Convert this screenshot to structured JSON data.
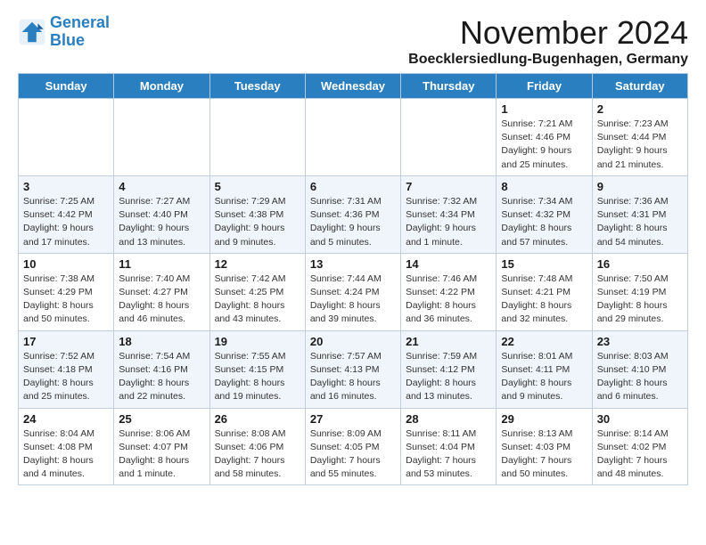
{
  "header": {
    "logo_line1": "General",
    "logo_line2": "Blue",
    "month_title": "November 2024",
    "location": "Boecklersiedlung-Bugenhagen, Germany"
  },
  "days_of_week": [
    "Sunday",
    "Monday",
    "Tuesday",
    "Wednesday",
    "Thursday",
    "Friday",
    "Saturday"
  ],
  "weeks": [
    [
      {
        "day": "",
        "info": ""
      },
      {
        "day": "",
        "info": ""
      },
      {
        "day": "",
        "info": ""
      },
      {
        "day": "",
        "info": ""
      },
      {
        "day": "",
        "info": ""
      },
      {
        "day": "1",
        "info": "Sunrise: 7:21 AM\nSunset: 4:46 PM\nDaylight: 9 hours\nand 25 minutes."
      },
      {
        "day": "2",
        "info": "Sunrise: 7:23 AM\nSunset: 4:44 PM\nDaylight: 9 hours\nand 21 minutes."
      }
    ],
    [
      {
        "day": "3",
        "info": "Sunrise: 7:25 AM\nSunset: 4:42 PM\nDaylight: 9 hours\nand 17 minutes."
      },
      {
        "day": "4",
        "info": "Sunrise: 7:27 AM\nSunset: 4:40 PM\nDaylight: 9 hours\nand 13 minutes."
      },
      {
        "day": "5",
        "info": "Sunrise: 7:29 AM\nSunset: 4:38 PM\nDaylight: 9 hours\nand 9 minutes."
      },
      {
        "day": "6",
        "info": "Sunrise: 7:31 AM\nSunset: 4:36 PM\nDaylight: 9 hours\nand 5 minutes."
      },
      {
        "day": "7",
        "info": "Sunrise: 7:32 AM\nSunset: 4:34 PM\nDaylight: 9 hours\nand 1 minute."
      },
      {
        "day": "8",
        "info": "Sunrise: 7:34 AM\nSunset: 4:32 PM\nDaylight: 8 hours\nand 57 minutes."
      },
      {
        "day": "9",
        "info": "Sunrise: 7:36 AM\nSunset: 4:31 PM\nDaylight: 8 hours\nand 54 minutes."
      }
    ],
    [
      {
        "day": "10",
        "info": "Sunrise: 7:38 AM\nSunset: 4:29 PM\nDaylight: 8 hours\nand 50 minutes."
      },
      {
        "day": "11",
        "info": "Sunrise: 7:40 AM\nSunset: 4:27 PM\nDaylight: 8 hours\nand 46 minutes."
      },
      {
        "day": "12",
        "info": "Sunrise: 7:42 AM\nSunset: 4:25 PM\nDaylight: 8 hours\nand 43 minutes."
      },
      {
        "day": "13",
        "info": "Sunrise: 7:44 AM\nSunset: 4:24 PM\nDaylight: 8 hours\nand 39 minutes."
      },
      {
        "day": "14",
        "info": "Sunrise: 7:46 AM\nSunset: 4:22 PM\nDaylight: 8 hours\nand 36 minutes."
      },
      {
        "day": "15",
        "info": "Sunrise: 7:48 AM\nSunset: 4:21 PM\nDaylight: 8 hours\nand 32 minutes."
      },
      {
        "day": "16",
        "info": "Sunrise: 7:50 AM\nSunset: 4:19 PM\nDaylight: 8 hours\nand 29 minutes."
      }
    ],
    [
      {
        "day": "17",
        "info": "Sunrise: 7:52 AM\nSunset: 4:18 PM\nDaylight: 8 hours\nand 25 minutes."
      },
      {
        "day": "18",
        "info": "Sunrise: 7:54 AM\nSunset: 4:16 PM\nDaylight: 8 hours\nand 22 minutes."
      },
      {
        "day": "19",
        "info": "Sunrise: 7:55 AM\nSunset: 4:15 PM\nDaylight: 8 hours\nand 19 minutes."
      },
      {
        "day": "20",
        "info": "Sunrise: 7:57 AM\nSunset: 4:13 PM\nDaylight: 8 hours\nand 16 minutes."
      },
      {
        "day": "21",
        "info": "Sunrise: 7:59 AM\nSunset: 4:12 PM\nDaylight: 8 hours\nand 13 minutes."
      },
      {
        "day": "22",
        "info": "Sunrise: 8:01 AM\nSunset: 4:11 PM\nDaylight: 8 hours\nand 9 minutes."
      },
      {
        "day": "23",
        "info": "Sunrise: 8:03 AM\nSunset: 4:10 PM\nDaylight: 8 hours\nand 6 minutes."
      }
    ],
    [
      {
        "day": "24",
        "info": "Sunrise: 8:04 AM\nSunset: 4:08 PM\nDaylight: 8 hours\nand 4 minutes."
      },
      {
        "day": "25",
        "info": "Sunrise: 8:06 AM\nSunset: 4:07 PM\nDaylight: 8 hours\nand 1 minute."
      },
      {
        "day": "26",
        "info": "Sunrise: 8:08 AM\nSunset: 4:06 PM\nDaylight: 7 hours\nand 58 minutes."
      },
      {
        "day": "27",
        "info": "Sunrise: 8:09 AM\nSunset: 4:05 PM\nDaylight: 7 hours\nand 55 minutes."
      },
      {
        "day": "28",
        "info": "Sunrise: 8:11 AM\nSunset: 4:04 PM\nDaylight: 7 hours\nand 53 minutes."
      },
      {
        "day": "29",
        "info": "Sunrise: 8:13 AM\nSunset: 4:03 PM\nDaylight: 7 hours\nand 50 minutes."
      },
      {
        "day": "30",
        "info": "Sunrise: 8:14 AM\nSunset: 4:02 PM\nDaylight: 7 hours\nand 48 minutes."
      }
    ]
  ]
}
